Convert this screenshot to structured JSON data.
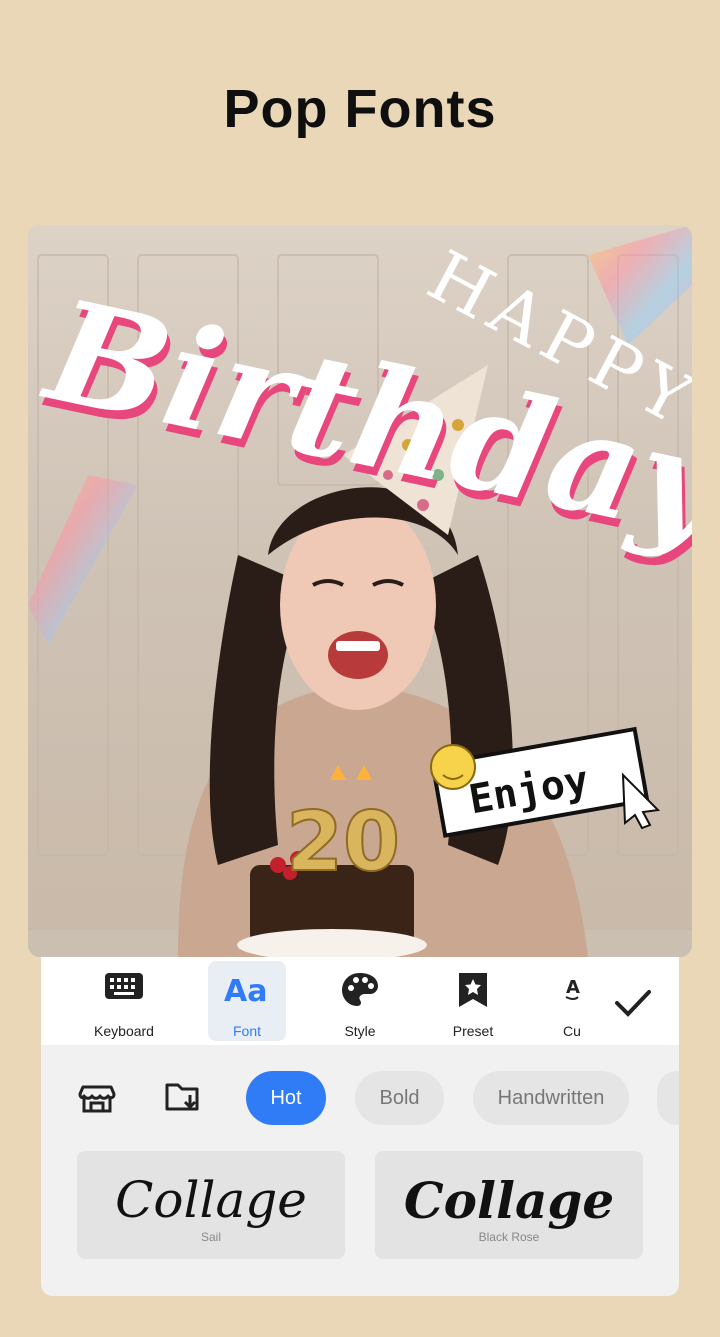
{
  "headline": "Pop Fonts",
  "canvas": {
    "text_happy": "HAPPY",
    "text_birthday": "Birthday",
    "text_candle": "20",
    "text_sticker": "Enjoy"
  },
  "toolbar": {
    "tools": [
      {
        "label": "Keyboard",
        "icon": "keyboard-icon"
      },
      {
        "label": "Font",
        "icon": "font-icon",
        "active": true
      },
      {
        "label": "Style",
        "icon": "palette-icon"
      },
      {
        "label": "Preset",
        "icon": "star-bookmark-icon"
      },
      {
        "label": "Cu",
        "icon": "curve-text-icon"
      }
    ],
    "confirm_icon": "checkmark-icon"
  },
  "categories": {
    "icons": [
      "store-icon",
      "folder-download-icon"
    ],
    "chips": [
      "Hot",
      "Bold",
      "Handwritten"
    ],
    "active": "Hot"
  },
  "fonts": [
    {
      "sample": "Collage",
      "name": "Sail"
    },
    {
      "sample": "Collage",
      "name": "Black Rose"
    }
  ],
  "colors": {
    "background": "#ead7b7",
    "accent": "#2f7cf6",
    "birthday_outline": "#e8477d"
  }
}
